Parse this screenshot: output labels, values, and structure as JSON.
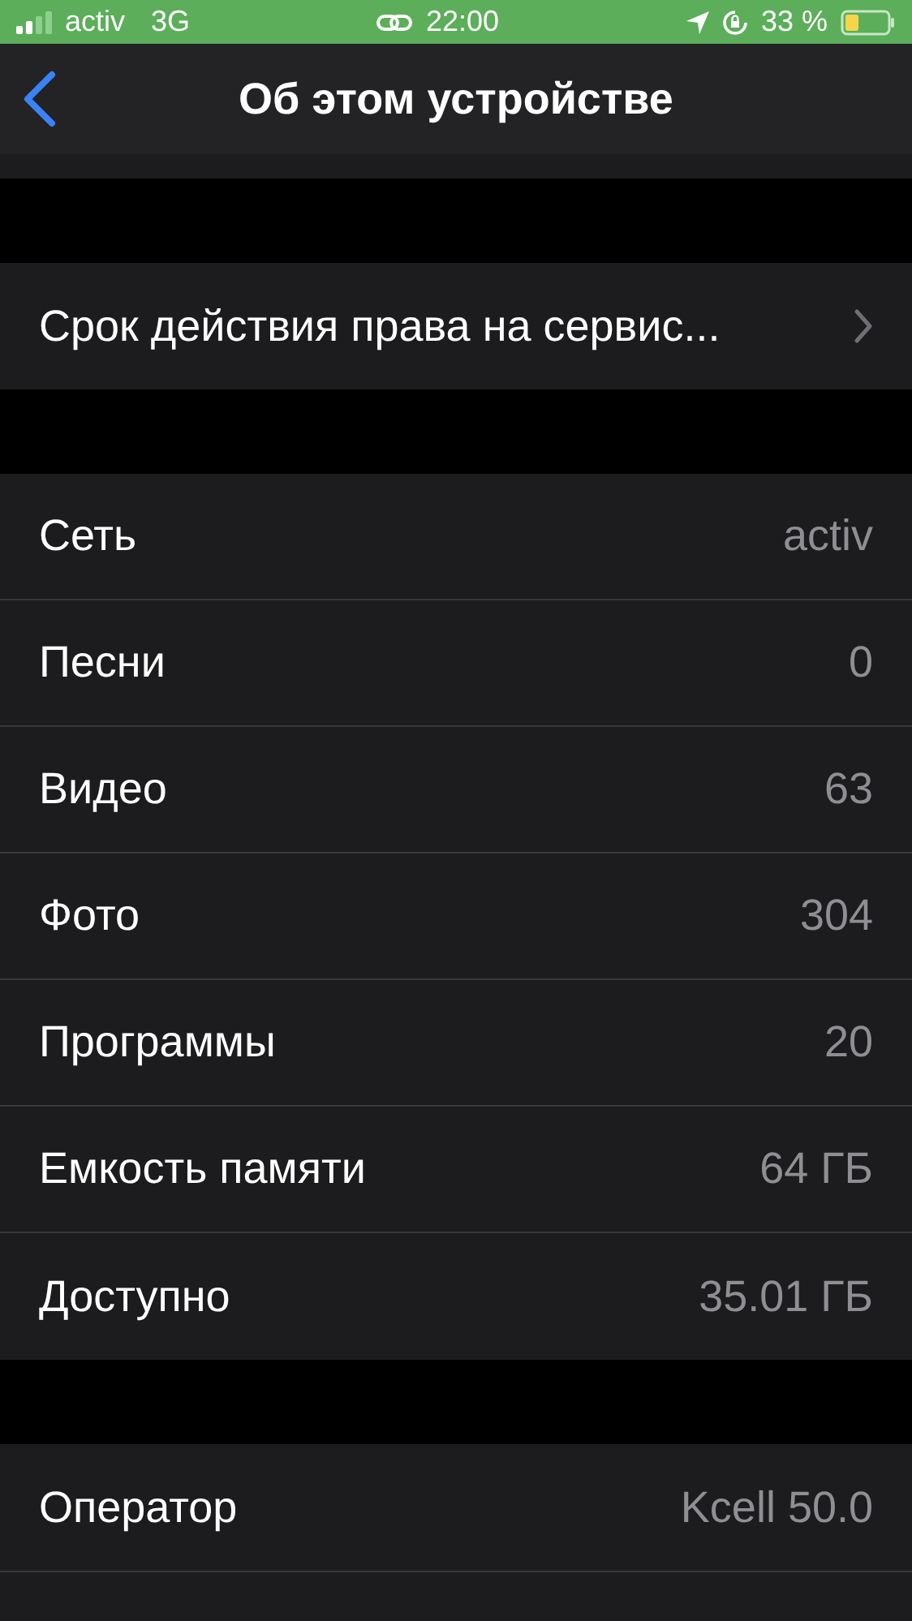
{
  "status_bar": {
    "carrier": "activ",
    "network": "3G",
    "time": "22:00",
    "battery_percent": "33 %"
  },
  "nav": {
    "title": "Об этом устройстве"
  },
  "groups": [
    {
      "rows": [
        {
          "label": "Срок действия права на сервис...",
          "kind": "link"
        }
      ]
    },
    {
      "rows": [
        {
          "label": "Сеть",
          "value": "activ",
          "kind": "info"
        },
        {
          "label": "Песни",
          "value": "0",
          "kind": "info"
        },
        {
          "label": "Видео",
          "value": "63",
          "kind": "info"
        },
        {
          "label": "Фото",
          "value": "304",
          "kind": "info"
        },
        {
          "label": "Программы",
          "value": "20",
          "kind": "info"
        },
        {
          "label": "Емкость памяти",
          "value": "64 ГБ",
          "kind": "info"
        },
        {
          "label": "Доступно",
          "value": "35.01 ГБ",
          "kind": "info"
        }
      ]
    },
    {
      "rows": [
        {
          "label": "Оператор",
          "value": "Kcell 50.0",
          "kind": "info"
        }
      ]
    }
  ]
}
